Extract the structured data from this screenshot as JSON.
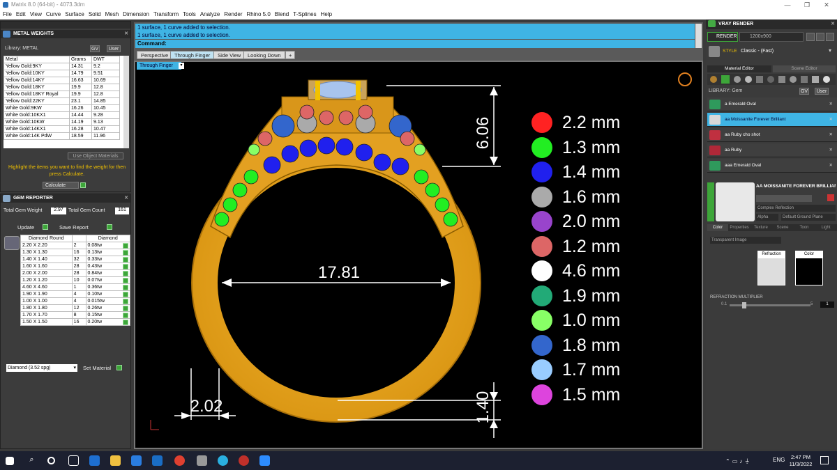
{
  "window": {
    "title": "Matrix 8.0 (64-bit) - 4073.3dm",
    "minimize": "—",
    "restore": "❐",
    "close": "✕"
  },
  "menu": [
    "File",
    "Edit",
    "View",
    "Curve",
    "Surface",
    "Solid",
    "Mesh",
    "Dimension",
    "Transform",
    "Tools",
    "Analyze",
    "Render",
    "Rhino 5.0",
    "Blend",
    "T-Splines",
    "Help"
  ],
  "metal_weights": {
    "title": "METAL WEIGHTS",
    "library_label": "Library: METAL",
    "gv": "GV",
    "user": "User",
    "columns": [
      "Metal",
      "Grams",
      "DWT"
    ],
    "rows": [
      [
        "Yellow Gold:9KY",
        "14.31",
        "9.2"
      ],
      [
        "Yellow Gold:10KY",
        "14.79",
        "9.51"
      ],
      [
        "Yellow Gold:14KY",
        "16.63",
        "10.69"
      ],
      [
        "Yellow Gold:18KY",
        "19.9",
        "12.8"
      ],
      [
        "Yellow Gold:18KY Royal",
        "19.9",
        "12.8"
      ],
      [
        "Yellow Gold:22KY",
        "23.1",
        "14.85"
      ],
      [
        "White Gold:9KW",
        "16.26",
        "10.45"
      ],
      [
        "White Gold:10KX1",
        "14.44",
        "9.28"
      ],
      [
        "White Gold:10KW",
        "14.19",
        "9.13"
      ],
      [
        "White Gold:14KX1",
        "16.28",
        "10.47"
      ],
      [
        "White Gold:14K PdW",
        "18.59",
        "11.96"
      ]
    ],
    "use_object_materials": "Use Object Materials",
    "instructions": "Highlight the items you want to find the weight for then press Calculate.",
    "calculate": "Calculate"
  },
  "gem_reporter": {
    "title": "GEM REPORTER",
    "total_weight_label": "Total Gem Weight",
    "total_weight": "2.97",
    "total_count_label": "Total Gem Count",
    "total_count": "161",
    "update": "Update",
    "save_report": "Save Report",
    "columns": [
      "Diamond Round",
      "",
      "Diamond"
    ],
    "rows": [
      [
        "2.20 X 2.20",
        "2",
        "0.08tw"
      ],
      [
        "1.30 X 1.30",
        "16",
        "0.13tw"
      ],
      [
        "1.40 X 1.40",
        "32",
        "0.33tw"
      ],
      [
        "1.60 X 1.60",
        "28",
        "0.43tw"
      ],
      [
        "2.00 X 2.00",
        "28",
        "0.84tw"
      ],
      [
        "1.20 X 1.20",
        "10",
        "0.07tw"
      ],
      [
        "4.60 X 4.60",
        "1",
        "0.36tw"
      ],
      [
        "1.90 X 1.90",
        "4",
        "0.10tw"
      ],
      [
        "1.00 X 1.00",
        "4",
        "0.015tw"
      ],
      [
        "1.80 X 1.80",
        "12",
        "0.26tw"
      ],
      [
        "1.70 X 1.70",
        "8",
        "0.15tw"
      ],
      [
        "1.50 X 1.50",
        "16",
        "0.20tw"
      ]
    ],
    "material_select": "Diamond    (3.52 spg)",
    "set_material": "Set Material"
  },
  "command": {
    "log": [
      "1 surface, 1 curve added to selection.",
      "1 surface, 1 curve added to selection."
    ],
    "prompt": "Command:"
  },
  "viewport_tabs": [
    "Perspective",
    "Through Finger",
    "Side View",
    "Looking Down",
    "+"
  ],
  "active_view": "Through Finger",
  "dimensions": {
    "top_height": "6.06",
    "inner_diameter": "17.81",
    "shank_width": "2.02",
    "bottom_thickness": "1.40"
  },
  "legend": [
    {
      "color": "#ff2222",
      "label": "2.2  mm"
    },
    {
      "color": "#22ee22",
      "label": "1.3  mm"
    },
    {
      "color": "#2020ee",
      "label": "1.4  mm"
    },
    {
      "color": "#aaaaaa",
      "label": "1.6  mm"
    },
    {
      "color": "#9944cc",
      "label": "2.0  mm"
    },
    {
      "color": "#dd6666",
      "label": "1.2  mm"
    },
    {
      "color": "#ffffff",
      "label": "4.6  mm"
    },
    {
      "color": "#22aa77",
      "label": "1.9  mm"
    },
    {
      "color": "#88ff66",
      "label": "1.0  mm"
    },
    {
      "color": "#3366cc",
      "label": "1.8  mm"
    },
    {
      "color": "#99ccff",
      "label": "1.7  mm"
    },
    {
      "color": "#dd44dd",
      "label": "1.5  mm"
    }
  ],
  "vray": {
    "title": "VRAY RENDER",
    "render": "RENDER",
    "resolution": "1200x900",
    "style_label": "STYLE",
    "style_value": "Classic - (Fast)",
    "tabs": [
      "Material Editor",
      "Scene Editor"
    ],
    "library_label": "LIBRARY: Gem",
    "library_items": [
      {
        "name": "a Emerald Oval",
        "color": "#2f9a5c"
      },
      {
        "name": "aa Moissanite Forever Brilliant",
        "color": "#d8d8d8"
      },
      {
        "name": "aa Ruby cho shot",
        "color": "#c03040"
      },
      {
        "name": "aa Ruby",
        "color": "#b02838"
      },
      {
        "name": "aaa Emerald Oval",
        "color": "#2f9a5c"
      }
    ],
    "selected_material": "AA MOISSANITE FOREVER BRILLIANT",
    "material_type": "Complex Reflection",
    "alpha": "Alpha",
    "ground_plane": "Default Ground Plane",
    "sub_tabs": [
      "Color",
      "Properties",
      "Texture",
      "Scene",
      "Toon",
      "Light"
    ],
    "transparent_image": "Transparent Image",
    "refraction_label": "Refraction",
    "color_label": "Color",
    "refraction_multiplier": "REFRACTION MULTIPLIER",
    "rm_min": "0.1",
    "rm_max": "5",
    "rm_value": "1"
  },
  "taskbar": {
    "lang": "ENG",
    "time": "2:47 PM",
    "date": "11/3/2022"
  }
}
